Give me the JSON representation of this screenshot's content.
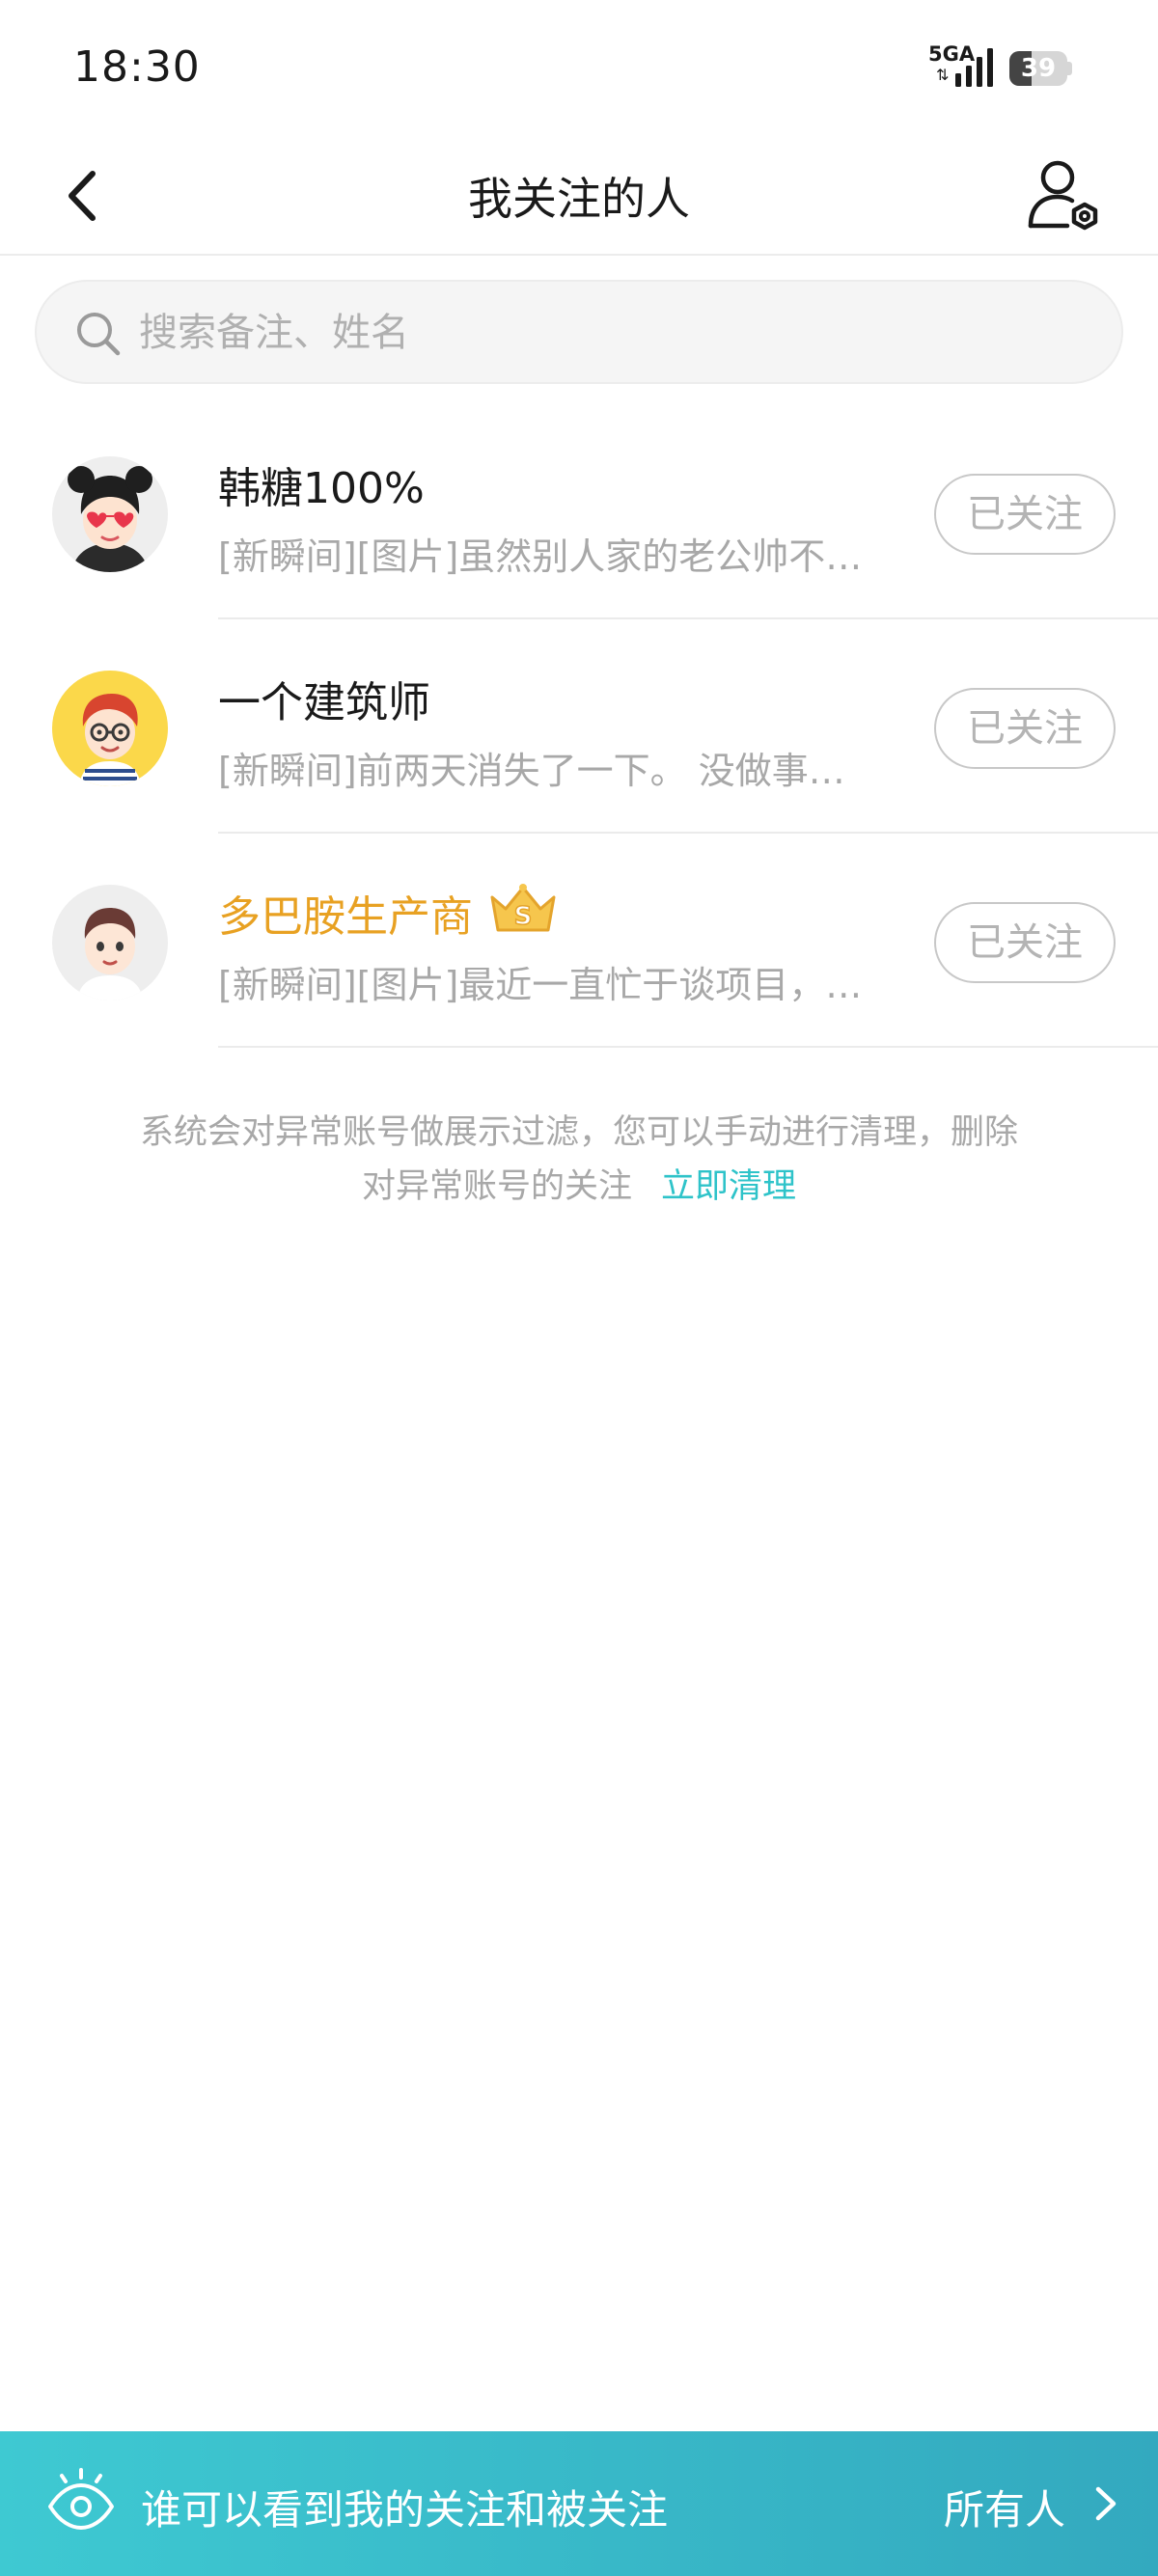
{
  "status_bar": {
    "time": "18:30",
    "network": "5GA",
    "network_arrows": "⇅",
    "battery": "39",
    "battery_level": 0.39
  },
  "header": {
    "title": "我关注的人",
    "back_icon": "chevron-left-icon",
    "settings_icon": "user-settings-icon"
  },
  "search": {
    "placeholder": "搜索备注、姓名",
    "value": ""
  },
  "follows": [
    {
      "name": "韩糖100%",
      "desc": "[新瞬间][图片]虽然别人家的老公帅不…",
      "button": "已关注",
      "vip": false,
      "avatar_icon": "avatar-girl-heart-glasses"
    },
    {
      "name": "一个建筑师",
      "desc": "[新瞬间]前两天消失了一下。 没做事…",
      "button": "已关注",
      "vip": false,
      "avatar_icon": "avatar-red-hair-glasses"
    },
    {
      "name": "多巴胺生产商",
      "desc": "[新瞬间][图片]最近一直忙于谈项目，…",
      "button": "已关注",
      "vip": true,
      "vip_badge": "S",
      "avatar_icon": "avatar-boy"
    }
  ],
  "notice": {
    "line1": "系统会对异常账号做展示过滤，您可以手动进行清理，删除",
    "line2": "对异常账号的关注",
    "link": "立即清理"
  },
  "bottom_bar": {
    "text": "谁可以看到我的关注和被关注",
    "value": "所有人",
    "icon": "eye-icon"
  },
  "colors": {
    "accent": "#2ec3c9",
    "vip_name": "#e8a122",
    "bottom_bar_start": "#3ec9d2",
    "bottom_bar_end": "#33a9bf"
  }
}
